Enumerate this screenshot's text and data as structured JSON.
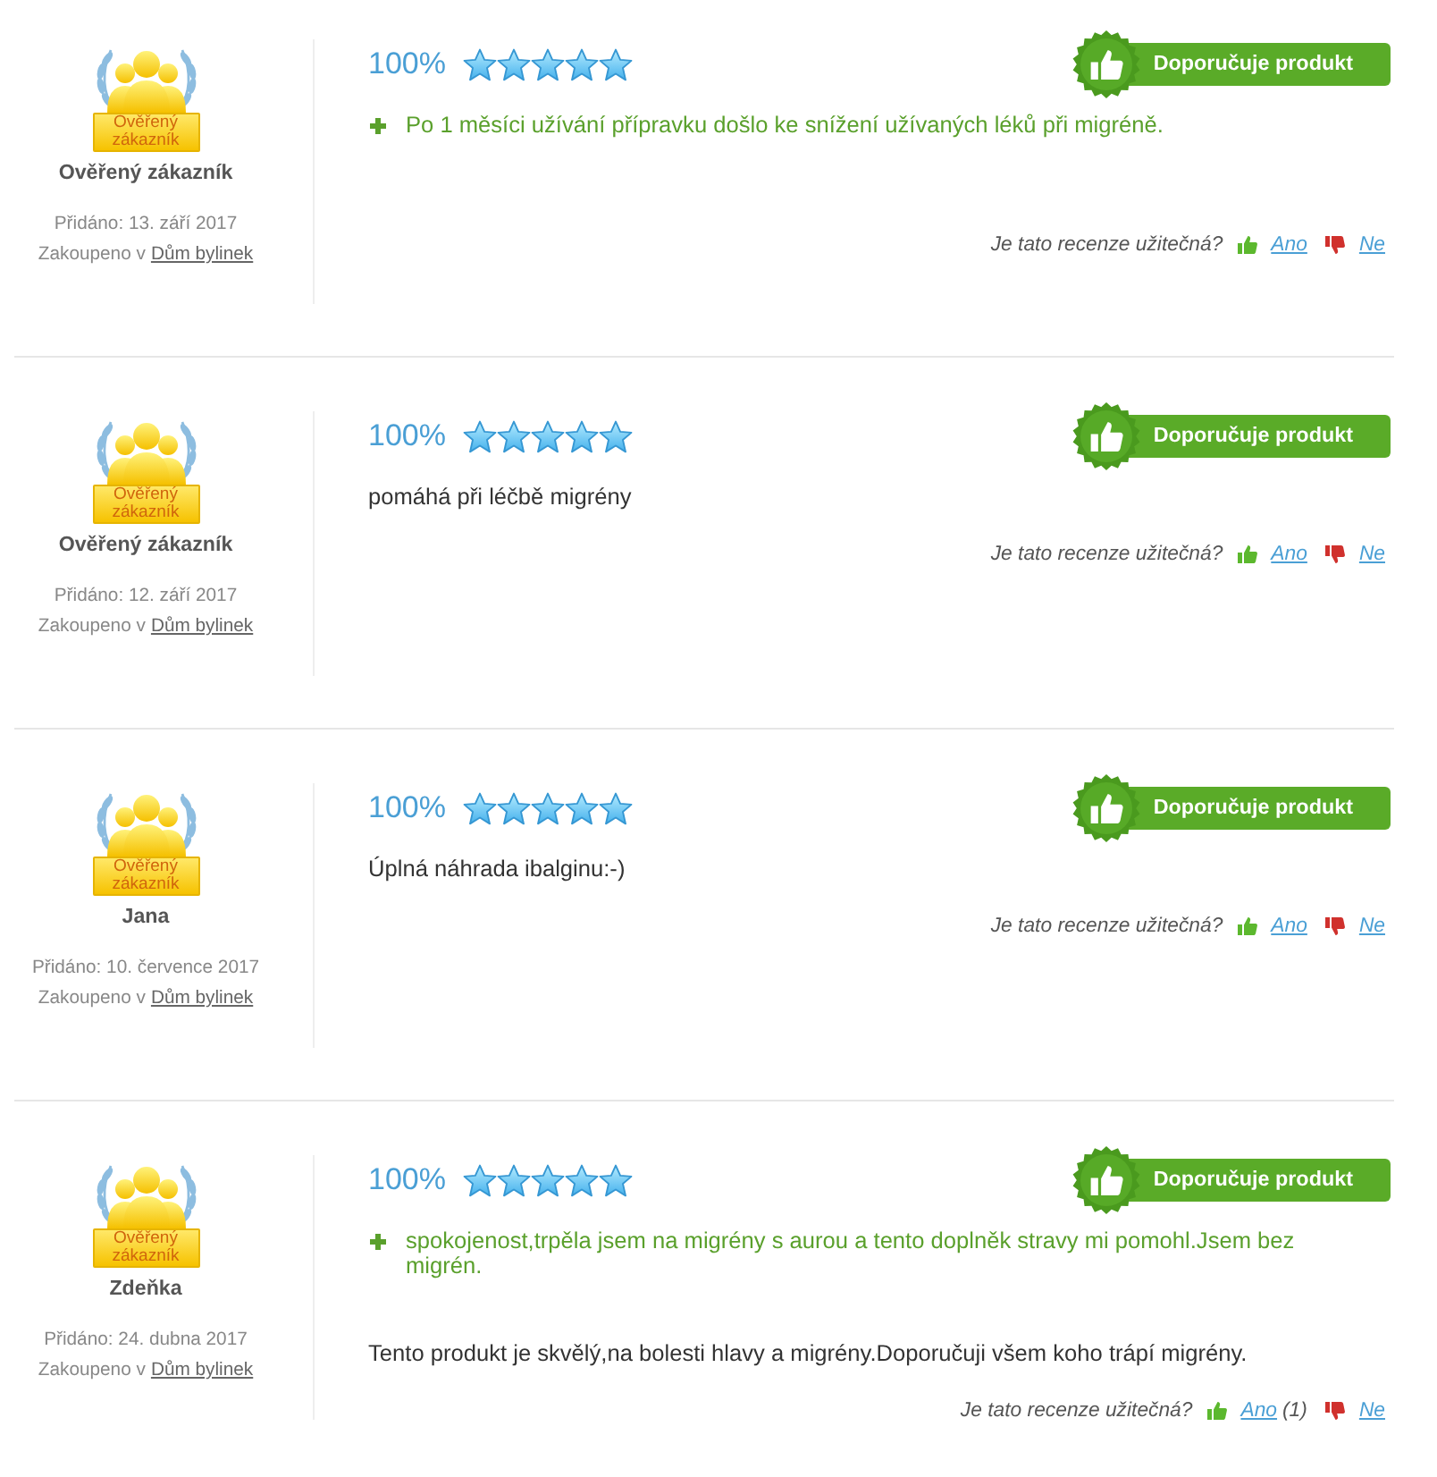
{
  "reviews": [
    {
      "badge_label": "Ověřený zákazník",
      "author": "Ověřený zákazník",
      "added": "Přidáno: 13. září 2017",
      "purchased_prefix": "Zakoupeno v",
      "shop": "Dům bylinek",
      "score": "100%",
      "stars": 5,
      "recommendation": "Doporučuje produkt",
      "pros": [
        "Po 1 měsíci užívání přípravku došlo ke snížení užívaných léků při migréně."
      ],
      "helpful": {
        "question": "Je tato recenze užitečná?",
        "yes": "Ano",
        "no": "Ne"
      }
    },
    {
      "badge_label": "Ověřený zákazník",
      "author": "Ověřený zákazník",
      "added": "Přidáno: 12. září 2017",
      "purchased_prefix": "Zakoupeno v",
      "shop": "Dům bylinek",
      "score": "100%",
      "stars": 5,
      "recommendation": "Doporučuje produkt",
      "text": "pomáhá při léčbě migrény",
      "helpful": {
        "question": "Je tato recenze užitečná?",
        "yes": "Ano",
        "no": "Ne"
      }
    },
    {
      "badge_label": "Ověřený zákazník",
      "author": "Jana",
      "added": "Přidáno: 10. července 2017",
      "purchased_prefix": "Zakoupeno v",
      "shop": "Dům bylinek",
      "score": "100%",
      "stars": 5,
      "recommendation": "Doporučuje produkt",
      "text": "Úplná náhrada ibalginu:-)",
      "helpful": {
        "question": "Je tato recenze užitečná?",
        "yes": "Ano",
        "no": "Ne"
      }
    },
    {
      "badge_label": "Ověřený zákazník",
      "author": "Zdeňka",
      "added": "Přidáno: 24. dubna 2017",
      "purchased_prefix": "Zakoupeno v",
      "shop": "Dům bylinek",
      "score": "100%",
      "stars": 5,
      "recommendation": "Doporučuje produkt",
      "pros": [
        "spokojenost,trpěla jsem na migrény s aurou a tento doplněk stravy mi pomohl.Jsem bez migrén."
      ],
      "text": "Tento produkt je skvělý,na bolesti hlavy a migrény.Doporučuji všem koho trápí migrény.",
      "helpful": {
        "question": "Je tato recenze užitečná?",
        "yes": "Ano",
        "yes_count": "(1)",
        "no": "Ne"
      }
    }
  ]
}
